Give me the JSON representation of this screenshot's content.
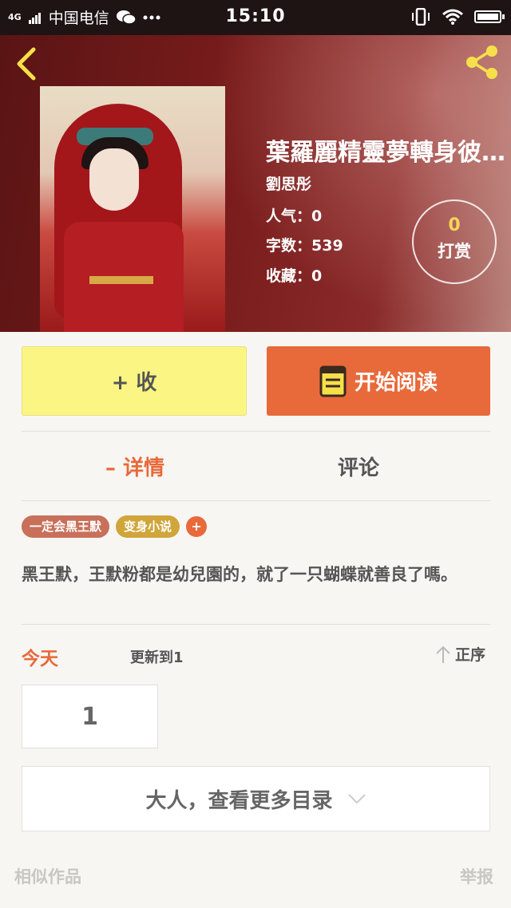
{
  "statusbar": {
    "signal": "4G",
    "carrier": "中国电信",
    "time": "15:10"
  },
  "book": {
    "title": "葉羅麗精靈夢轉身彼…",
    "author": "劉思彤",
    "popularity": "人气：0",
    "word_count": "字数：539",
    "favorites": "收藏：0"
  },
  "tip": {
    "count": "0",
    "label": "打赏"
  },
  "actions": {
    "collect_label": "+ 收",
    "read_label": "开始阅读"
  },
  "tabs": {
    "detail": "– 详情",
    "comment": "评论"
  },
  "tags": [
    "一定会黑王默",
    "变身小说"
  ],
  "tag_add": "+",
  "description": "黑王默，王默粉都是幼兒園的，就了一只蝴蝶就善良了嗎。",
  "updates": {
    "today": "今天",
    "update_to": "更新到1",
    "sort": "正序",
    "chapter": "1",
    "more": "大人，查看更多目录"
  },
  "footer": {
    "similar": "相似作品",
    "report": "举报"
  },
  "colors": {
    "accent": "#e8693a",
    "collect_bg": "#fbf684",
    "tip_gold": "#f6d45a"
  },
  "icons": {
    "back": "back-arrow-icon",
    "share": "share-icon",
    "book": "book-icon",
    "sort": "arrow-up-icon",
    "expand": "chevron-down-icon"
  }
}
